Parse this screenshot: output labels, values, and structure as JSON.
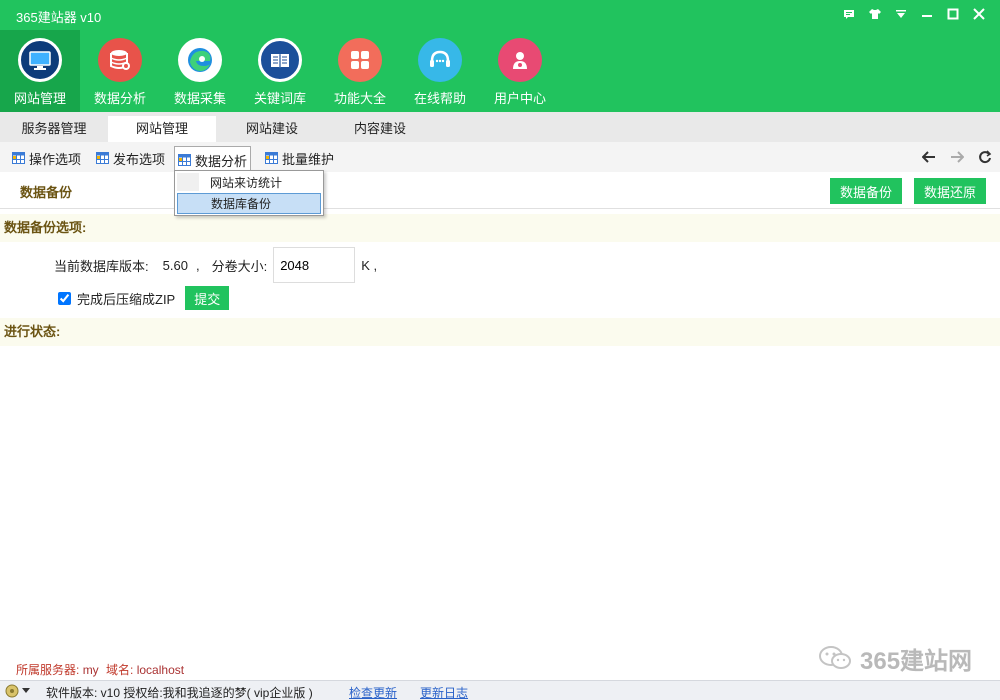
{
  "app": {
    "title": "365建站器 v10"
  },
  "nav": [
    {
      "label": "网站管理",
      "icon": "monitor-icon",
      "color": "#1c6fd1"
    },
    {
      "label": "数据分析",
      "icon": "database-icon",
      "color": "#e8534a"
    },
    {
      "label": "数据采集",
      "icon": "edge-icon",
      "color": "#1f8fe0"
    },
    {
      "label": "关键词库",
      "icon": "book-icon",
      "color": "#1c5fb8"
    },
    {
      "label": "功能大全",
      "icon": "grid-icon",
      "color": "#f26d5b"
    },
    {
      "label": "在线帮助",
      "icon": "headset-icon",
      "color": "#37b8e8"
    },
    {
      "label": "用户中心",
      "icon": "user-icon",
      "color": "#e84a73"
    }
  ],
  "tabs": [
    "服务器管理",
    "网站管理",
    "网站建设",
    "内容建设"
  ],
  "subtoolbar": [
    "操作选项",
    "发布选项",
    "数据分析",
    "批量维护"
  ],
  "dropdown": [
    "网站来访统计",
    "数据库备份"
  ],
  "page": {
    "title": "数据备份",
    "backup_btn": "数据备份",
    "restore_btn": "数据还原"
  },
  "options": {
    "section_title": "数据备份选项:",
    "db_version_label": "当前数据库版本:",
    "db_version": "5.60",
    "comma1": ",",
    "volume_label": "分卷大小:",
    "volume_value": "2048",
    "unit": "K ,",
    "zip_label": "完成后压缩成ZIP",
    "submit": "提交"
  },
  "progress": {
    "section_title": "进行状态:"
  },
  "server": {
    "label": "所属服务器:",
    "server_value": "my",
    "domain_label": "域名:",
    "domain_value": "localhost"
  },
  "statusbar": {
    "version": "软件版本: v10   授权给:我和我追逐的梦( vip企业版 )",
    "check_update": "检查更新",
    "changelog": "更新日志"
  },
  "watermark": "365建站网"
}
